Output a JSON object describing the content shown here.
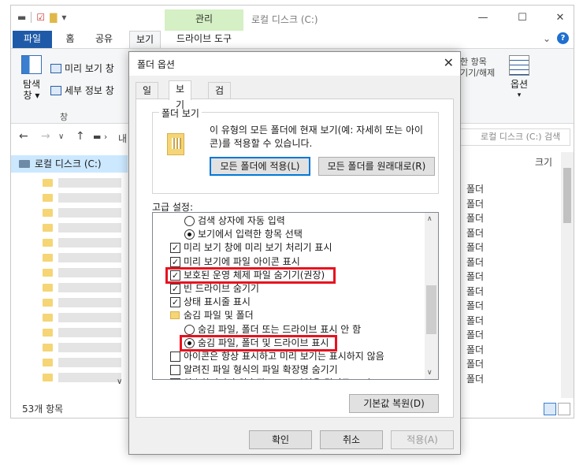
{
  "explorer": {
    "window_title": "로컬 디스크 (C:)",
    "manage_tab": "관리",
    "tabs": [
      "파일",
      "홈",
      "공유",
      "보기",
      "드라이브 도구"
    ],
    "ribbon": {
      "nav_pane_label": "탐색\n창 ▾",
      "preview_pane": "미리 보기 창",
      "details_pane": "세부 정보 창",
      "group_label": "창",
      "show_hide_partial": "한 항목\n기기/해제",
      "options": "옵션"
    },
    "address_partial": "내",
    "search_placeholder": "로컬 디스크 (C:) 검색",
    "nav_local_disk": "로컬 디스크 (C:)",
    "column_size": "크기",
    "file_types": [
      "폴더",
      "폴더",
      "폴더",
      "폴더",
      "폴더",
      "폴더",
      "폴더",
      "폴더",
      "폴더",
      "폴더",
      "폴더",
      "폴더",
      "폴더",
      "폴더"
    ],
    "status_items": "53개 항목"
  },
  "dialog": {
    "title": "폴더 옵션",
    "tabs": [
      "일반",
      "보기",
      "검색"
    ],
    "folder_view": {
      "legend": "폴더 보기",
      "description": "이 유형의 모든 폴더에 현재 보기(예: 자세히 또는 아이콘)를 적용할 수 있습니다.",
      "apply_button": "모든 폴더에 적용(L)",
      "reset_button": "모든 폴더를 원래대로(R)"
    },
    "advanced_label": "고급 설정:",
    "settings": [
      {
        "type": "radio",
        "checked": false,
        "indent": 2,
        "label": "검색 상자에 자동 입력"
      },
      {
        "type": "radio",
        "checked": true,
        "indent": 2,
        "label": "보기에서 입력한 항목 선택"
      },
      {
        "type": "check",
        "checked": true,
        "indent": 1,
        "label": "미리 보기 창에 미리 보기 처리기 표시"
      },
      {
        "type": "check",
        "checked": true,
        "indent": 1,
        "label": "미리 보기에 파일 아이콘 표시"
      },
      {
        "type": "check",
        "checked": true,
        "indent": 1,
        "label": "보호된 운영 체제 파일 숨기기(권장)"
      },
      {
        "type": "check",
        "checked": true,
        "indent": 1,
        "label": "빈 드라이브 숨기기"
      },
      {
        "type": "check",
        "checked": true,
        "indent": 1,
        "label": "상태 표시줄 표시"
      },
      {
        "type": "folder",
        "checked": false,
        "indent": 1,
        "label": "숨김 파일 및 폴더"
      },
      {
        "type": "radio",
        "checked": false,
        "indent": 2,
        "label": "숨김 파일, 폴더 또는 드라이브 표시 안 함"
      },
      {
        "type": "radio",
        "checked": true,
        "indent": 2,
        "label": "숨김 파일, 폴더 및 드라이브 표시"
      },
      {
        "type": "check",
        "checked": false,
        "indent": 1,
        "label": "아이콘은 항상 표시하고 미리 보기는 표시하지 않음"
      },
      {
        "type": "check",
        "checked": false,
        "indent": 1,
        "label": "알려진 파일 형식의 파일 확장명 숨기기"
      },
      {
        "type": "check",
        "checked": false,
        "indent": 1,
        "label": "암호화되거나 압축된 NTFS 파일을 컬러로 표시"
      }
    ],
    "restore_defaults": "기본값 복원(D)",
    "ok": "확인",
    "cancel": "취소",
    "apply": "적용(A)"
  },
  "colors": {
    "highlight": "#e8121f",
    "file_tab": "#1e5aa8",
    "manage_tab": "#d4f0c4",
    "selection": "#cce8ff"
  }
}
